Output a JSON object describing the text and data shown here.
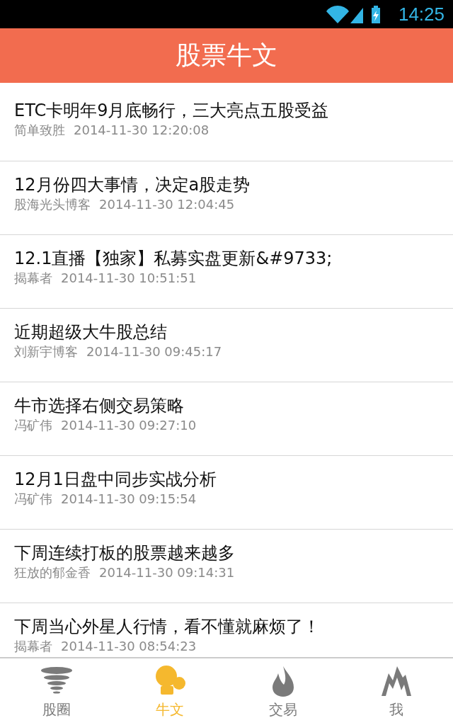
{
  "status_bar": {
    "time": "14:25"
  },
  "header": {
    "title": "股票牛文"
  },
  "articles": [
    {
      "title": "ETC卡明年9月底畅行，三大亮点五股受益",
      "source": "简单致胜",
      "time": "2014-11-30 12:20:08"
    },
    {
      "title": "12月份四大事情，决定a股走势",
      "source": "股海光头博客",
      "time": "2014-11-30 12:04:45"
    },
    {
      "title": "12.1直播【独家】私募实盘更新&#9733;",
      "source": "揭幕者",
      "time": "2014-11-30 10:51:51"
    },
    {
      "title": "近期超级大牛股总结",
      "source": "刘新宇博客",
      "time": "2014-11-30 09:45:17"
    },
    {
      "title": "牛市选择右侧交易策略",
      "source": "冯矿伟",
      "time": "2014-11-30 09:27:10"
    },
    {
      "title": "12月1日盘中同步实战分析",
      "source": "冯矿伟",
      "time": "2014-11-30 09:15:54"
    },
    {
      "title": "下周连续打板的股票越来越多",
      "source": "狂放的郁金香",
      "time": "2014-11-30 09:14:31"
    },
    {
      "title": "下周当心外星人行情，看不懂就麻烦了！",
      "source": "揭幕者",
      "time": "2014-11-30 08:54:23"
    }
  ],
  "tabs": [
    {
      "label": "股圈",
      "kind": "tornado",
      "selected": false
    },
    {
      "label": "牛文",
      "kind": "bulb",
      "selected": true
    },
    {
      "label": "交易",
      "kind": "flame",
      "selected": false
    },
    {
      "label": "我",
      "kind": "mountain",
      "selected": false
    }
  ]
}
